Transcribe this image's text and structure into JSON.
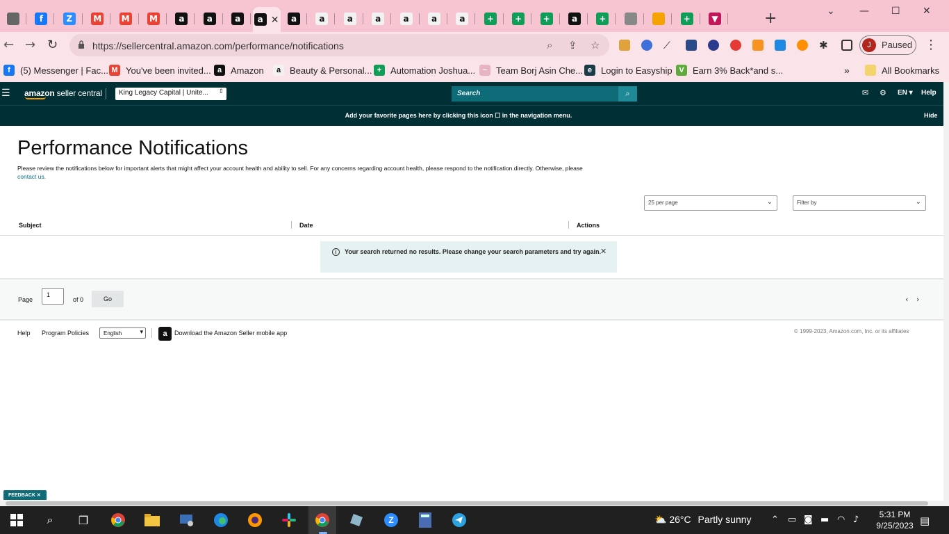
{
  "browser": {
    "url": "https://sellercentral.amazon.com/performance/notifications",
    "profile_status": "Paused",
    "profile_initial": "J",
    "tabs": [
      {
        "icon": "chrome-icon",
        "color": "#666666",
        "glyph": ""
      },
      {
        "icon": "facebook-icon",
        "color": "#1877f2",
        "glyph": "f"
      },
      {
        "icon": "zoom-icon",
        "color": "#2d8cff",
        "glyph": "Z"
      },
      {
        "icon": "gmail-icon",
        "color": "#ea4335",
        "glyph": "M"
      },
      {
        "icon": "gmail-icon",
        "color": "#ea4335",
        "glyph": "M"
      },
      {
        "icon": "gmail-icon",
        "color": "#ea4335",
        "glyph": "M"
      },
      {
        "icon": "amazon-icon",
        "color": "#111111",
        "glyph": "a"
      },
      {
        "icon": "amazon-icon",
        "color": "#111111",
        "glyph": "a"
      },
      {
        "icon": "amazon-icon",
        "color": "#111111",
        "glyph": "a"
      },
      {
        "icon": "amazon-icon",
        "color": "#111111",
        "glyph": "a"
      },
      {
        "icon": "amazon-icon",
        "color": "#111111",
        "glyph": "a"
      },
      {
        "icon": "amazon-smile-icon",
        "color": "#f2f2f2",
        "glyph": "a"
      },
      {
        "icon": "amazon-smile-icon",
        "color": "#f2f2f2",
        "glyph": "a"
      },
      {
        "icon": "amazon-smile-icon",
        "color": "#f2f2f2",
        "glyph": "a"
      },
      {
        "icon": "amazon-smile-icon",
        "color": "#f2f2f2",
        "glyph": "a"
      },
      {
        "icon": "amazon-smile-icon",
        "color": "#f2f2f2",
        "glyph": "a"
      },
      {
        "icon": "amazon-smile-icon",
        "color": "#f2f2f2",
        "glyph": "a"
      },
      {
        "icon": "sheets-icon",
        "color": "#0f9d58",
        "glyph": "+"
      },
      {
        "icon": "sheets-icon",
        "color": "#0f9d58",
        "glyph": "+"
      },
      {
        "icon": "sheets-icon",
        "color": "#0f9d58",
        "glyph": "+"
      },
      {
        "icon": "amazon-icon",
        "color": "#111111",
        "glyph": "a"
      },
      {
        "icon": "sheets-icon",
        "color": "#0f9d58",
        "glyph": "+"
      },
      {
        "icon": "globe-icon",
        "color": "#888888",
        "glyph": ""
      },
      {
        "icon": "pencil-icon",
        "color": "#f4a300",
        "glyph": ""
      },
      {
        "icon": "sheets-icon",
        "color": "#0f9d58",
        "glyph": "+"
      },
      {
        "icon": "triangle-icon",
        "color": "#c2185b",
        "glyph": "▼"
      }
    ],
    "active_tab_index": 9
  },
  "bookmarks": [
    {
      "label": "(5) Messenger | Fac...",
      "icon": "facebook-icon",
      "color": "#1877f2",
      "glyph": "f"
    },
    {
      "label": "You've been invited...",
      "icon": "gmail-icon",
      "color": "#ea4335",
      "glyph": "M"
    },
    {
      "label": "Amazon",
      "icon": "amazon-icon",
      "color": "#111111",
      "glyph": "a"
    },
    {
      "label": "Beauty & Personal...",
      "icon": "amazon-smile-icon",
      "color": "#f2f2f2",
      "glyph": "a"
    },
    {
      "label": "Automation Joshua...",
      "icon": "sheets-icon",
      "color": "#0f9d58",
      "glyph": "+"
    },
    {
      "label": "Team Borj Asin Che...",
      "icon": "wave-icon",
      "color": "#e8b4c2",
      "glyph": "~"
    },
    {
      "label": "Login to Easyship",
      "icon": "easyship-icon",
      "color": "#1a3b47",
      "glyph": "e"
    },
    {
      "label": "Earn 3% Back*and s...",
      "icon": "rakuten-icon",
      "color": "#5eaa3a",
      "glyph": "V"
    }
  ],
  "all_bookmarks_label": "All Bookmarks",
  "seller_central": {
    "logo_text": "amazon",
    "logo_sub": "seller central",
    "account": "King Legacy Capital | Unite...",
    "search_placeholder": "Search",
    "lang": "EN",
    "help": "Help",
    "banner": "Add your favorite pages here by clicking this icon ☐ in the navigation menu.",
    "banner_hide": "Hide"
  },
  "page": {
    "title": "Performance Notifications",
    "description": "Please review the notifications below for important alerts that might affect your account health and ability to sell. For any concerns regarding account health, please respond to the notification directly. Otherwise, please",
    "contact_link": "contact us.",
    "per_page": "25 per page",
    "filter_by": "Filter by",
    "columns": [
      "Subject",
      "Date",
      "Actions"
    ],
    "alert": "Your search returned no results. Please change your search parameters and try again.",
    "pager": {
      "page_label": "Page",
      "page_value": "1",
      "of_label": "of 0",
      "go": "Go"
    }
  },
  "footer": {
    "help": "Help",
    "program_policies": "Program Policies",
    "language": "English",
    "app": "Download the Amazon Seller mobile app",
    "copyright": "© 1999-2023, Amazon.com, Inc. or its affiliates"
  },
  "feedback": "FEEDBACK ✕",
  "taskbar": {
    "weather_temp": "26°C",
    "weather_desc": "Partly sunny",
    "time": "5:31 PM",
    "date": "9/25/2023"
  }
}
